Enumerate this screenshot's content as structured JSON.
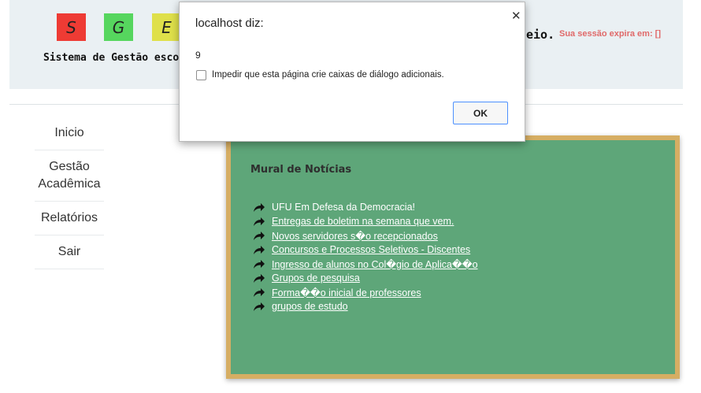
{
  "header": {
    "logo_letters": [
      "S",
      "G",
      "E"
    ],
    "logo_colors": [
      "#ee3b34",
      "#56d65e",
      "#dfe04a"
    ],
    "system_name": "Sistema de Gestão esco",
    "right_text_fragment": "eio.",
    "session_text": "Sua sessão expira em: []"
  },
  "sidebar": {
    "items": [
      {
        "label": "Inicio"
      },
      {
        "label": "Gestão Acadêmica"
      },
      {
        "label": "Relatórios"
      },
      {
        "label": "Sair"
      }
    ]
  },
  "board": {
    "title": "Mural de Notícias",
    "arrow_icon": "share-arrow-icon",
    "news": [
      {
        "label": "UFU Em Defesa da Democracia!"
      },
      {
        "label": "Entregas de boletim na semana que vem."
      },
      {
        "label": "Novos servidores s\u0000o recepcionados"
      },
      {
        "label": "Concursos e Processos Seletivos - Discentes"
      },
      {
        "label": "Ingresso de alunos no Col\u0000gio de Aplica\u0000\u0000o"
      },
      {
        "label": "Grupos de pesquisa"
      },
      {
        "label": "Forma\u0000\u0000o inicial de professores"
      },
      {
        "label": "grupos de estudo"
      }
    ]
  },
  "dialog": {
    "title": "localhost diz:",
    "message": "9",
    "checkbox_label": "Impedir que esta página crie caixas de diálogo adicionais.",
    "ok_label": "OK",
    "close_icon": "close-icon"
  }
}
